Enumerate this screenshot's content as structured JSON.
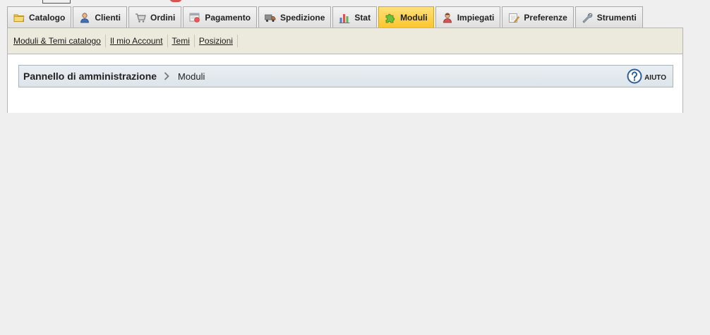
{
  "tabs": [
    {
      "label": "Catalogo",
      "icon": "folder-icon",
      "active": false
    },
    {
      "label": "Clienti",
      "icon": "customer-icon",
      "active": false
    },
    {
      "label": "Ordini",
      "icon": "cart-icon",
      "active": false
    },
    {
      "label": "Pagamento",
      "icon": "payment-icon",
      "active": false
    },
    {
      "label": "Spedizione",
      "icon": "truck-icon",
      "active": false
    },
    {
      "label": "Stat",
      "icon": "bar-chart-icon",
      "active": false
    },
    {
      "label": "Moduli",
      "icon": "puzzle-icon",
      "active": true
    },
    {
      "label": "Impiegati",
      "icon": "employee-icon",
      "active": false
    },
    {
      "label": "Preferenze",
      "icon": "preferences-icon",
      "active": false
    },
    {
      "label": "Strumenti",
      "icon": "wrench-icon",
      "active": false
    }
  ],
  "subnav": [
    {
      "label": "Moduli & Temi catalogo"
    },
    {
      "label": "Il mio Account"
    },
    {
      "label": "Temi"
    },
    {
      "label": "Posizioni"
    }
  ],
  "toolbar": {
    "breadcrumb_root": "Pannello di amministrazione",
    "breadcrumb_current": "Moduli",
    "help_label": "AIUTO",
    "help_icon": "help-icon"
  },
  "colors": {
    "active_tab": "#fbc52a",
    "subbar_bg": "#ece9dd",
    "toolbar_bg": "#e3eaee",
    "page_bg": "#efefef"
  }
}
